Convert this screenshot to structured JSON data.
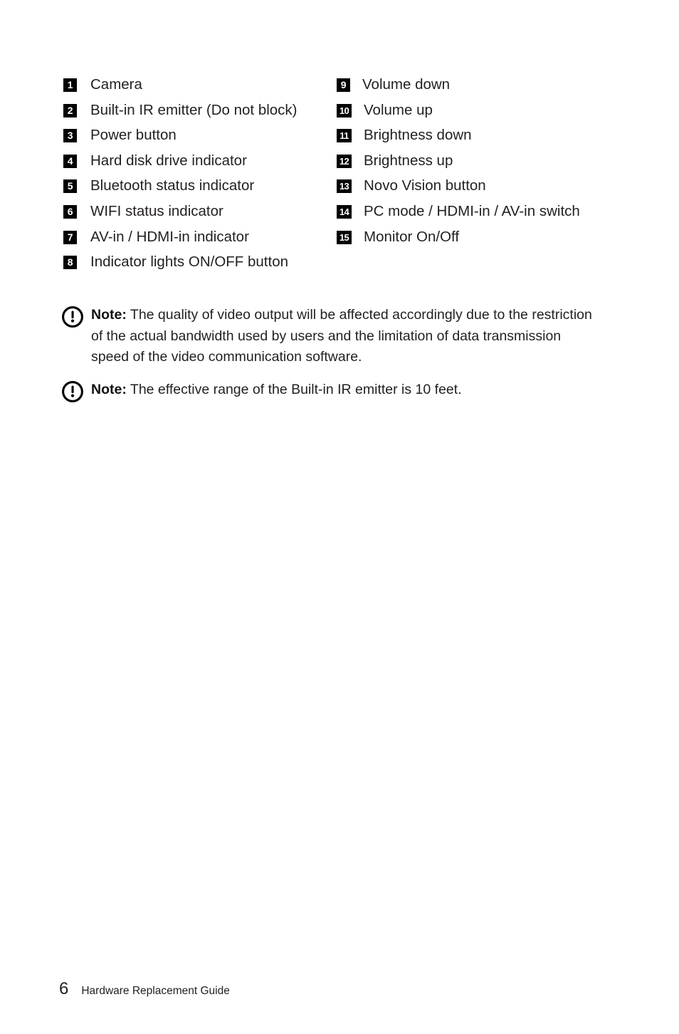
{
  "legend": {
    "left_column": [
      {
        "number": "1",
        "label": "Camera"
      },
      {
        "number": "2",
        "label": "Built-in IR emitter (Do not block)"
      },
      {
        "number": "3",
        "label": "Power button"
      },
      {
        "number": "4",
        "label": "Hard disk drive indicator"
      },
      {
        "number": "5",
        "label": "Bluetooth status indicator"
      },
      {
        "number": "6",
        "label": "WIFI status indicator"
      },
      {
        "number": "7",
        "label": "AV-in / HDMI-in indicator"
      },
      {
        "number": "8",
        "label": "Indicator lights ON/OFF button"
      }
    ],
    "right_column": [
      {
        "number": "9",
        "label": "Volume down"
      },
      {
        "number": "10",
        "label": "Volume up"
      },
      {
        "number": "11",
        "label": "Brightness down"
      },
      {
        "number": "12",
        "label": "Brightness up"
      },
      {
        "number": "13",
        "label": "Novo Vision button"
      },
      {
        "number": "14",
        "label": "PC mode / HDMI-in / AV-in switch"
      },
      {
        "number": "15",
        "label": "Monitor On/Off"
      }
    ]
  },
  "notes": [
    {
      "icon": "exclamation-circle-icon",
      "label": "Note:",
      "body": "The quality of video output will be affected accordingly due to the restriction of the actual bandwidth used by users and the limitation of data transmission speed of the video communication software."
    },
    {
      "icon": "exclamation-circle-icon",
      "label": "Note:",
      "body": "The effective range of the Built-in IR emitter is 10 feet."
    }
  ],
  "footer": {
    "page_number": "6",
    "document_title": "Hardware Replacement Guide"
  },
  "colors": {
    "text": "#231f20",
    "badge_background": "#000000",
    "badge_text": "#ffffff",
    "page_background": "#ffffff"
  }
}
